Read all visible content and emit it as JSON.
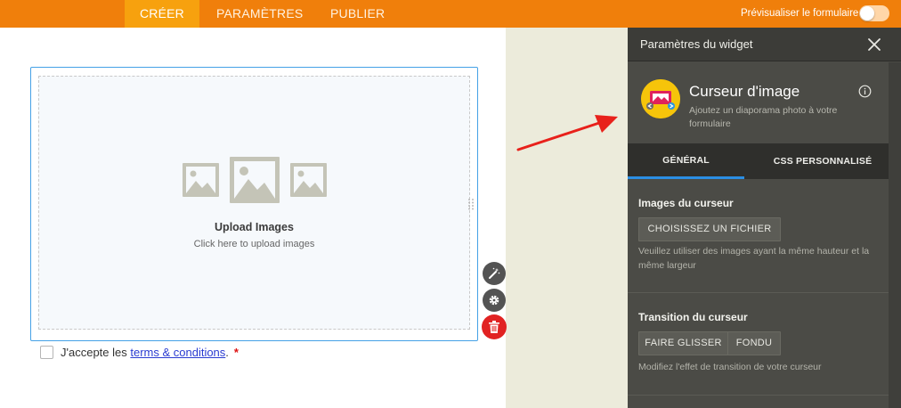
{
  "topbar": {
    "tabs": [
      {
        "label": "CRÉER"
      },
      {
        "label": "PARAMÈTRES"
      },
      {
        "label": "PUBLIER"
      }
    ],
    "preview_label": "Prévisualiser le formulaire",
    "preview_enabled": false,
    "accent_color": "#f07f0b"
  },
  "form": {
    "upload": {
      "title": "Upload Images",
      "subtitle": "Click here to upload images"
    },
    "terms": {
      "prefix": "J'accepte les ",
      "link": "terms & conditions",
      "suffix": ".",
      "required_mark": "*"
    }
  },
  "panel": {
    "title": "Paramètres du widget",
    "widget": {
      "name": "Curseur d'image",
      "description": "Ajoutez un diaporama photo à votre formulaire"
    },
    "tabs": [
      {
        "label": "GÉNÉRAL"
      },
      {
        "label": "CSS PERSONNALISÉ"
      }
    ],
    "sections": {
      "images": {
        "title": "Images du curseur",
        "button": "CHOISISSEZ UN FICHIER",
        "note": "Veuillez utiliser des images ayant la même hauteur et la même largeur"
      },
      "transition": {
        "title": "Transition du curseur",
        "options": [
          "FAIRE GLISSER",
          "FONDU"
        ],
        "note": "Modifiez l'effet de transition de votre curseur"
      }
    }
  }
}
